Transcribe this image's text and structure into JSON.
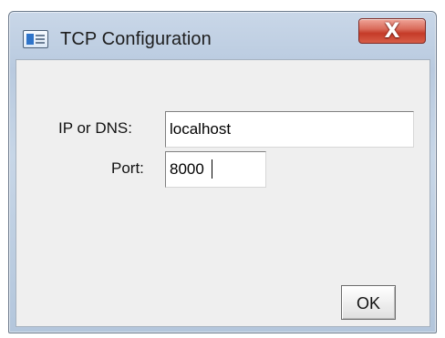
{
  "window": {
    "title": "TCP Configuration",
    "icon": "application-window-icon",
    "close_icon": "close-icon",
    "close_symbol": "X"
  },
  "form": {
    "ip_label": "IP or DNS:",
    "ip_value": "localhost",
    "port_label": "Port:",
    "port_value": "8000"
  },
  "actions": {
    "ok_label": "OK"
  },
  "colors": {
    "client_background": "#efefef",
    "close_button": "#c53b28",
    "titlebar": "#c9d7e8"
  }
}
